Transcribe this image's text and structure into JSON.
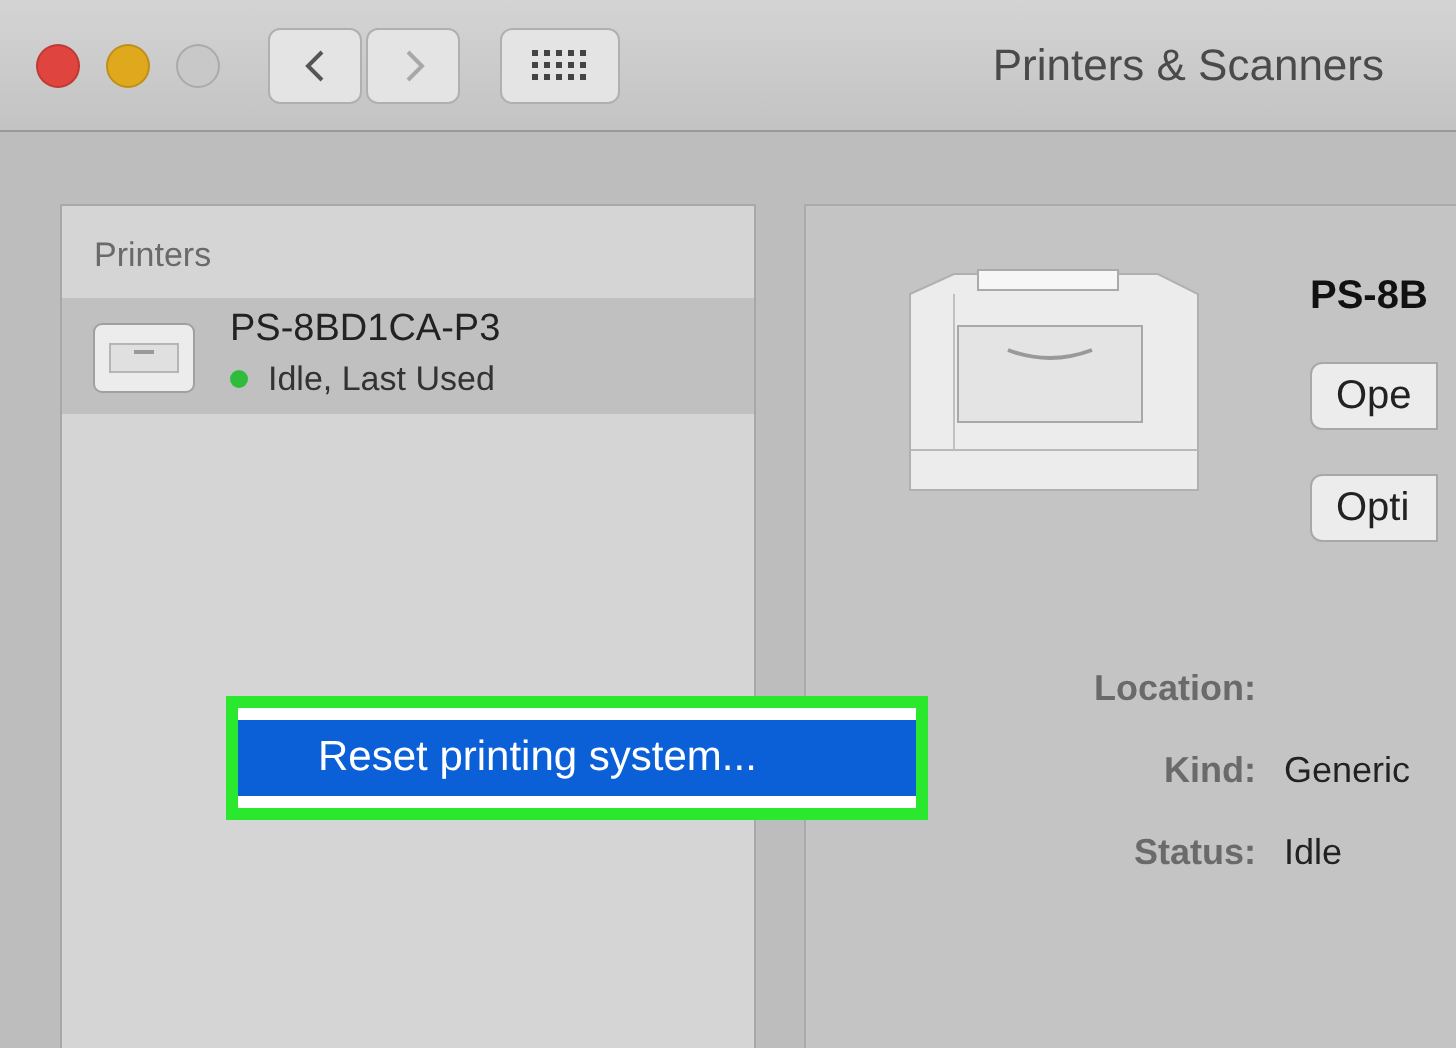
{
  "window": {
    "title": "Printers & Scanners"
  },
  "toolbar": {
    "back": {
      "disabled": false
    },
    "forward": {
      "disabled": true
    }
  },
  "printers_list": {
    "header": "Printers",
    "items": [
      {
        "name": "PS-8BD1CA-P3",
        "status": "Idle, Last Used",
        "color": "#2ebd3b",
        "selected": true
      }
    ]
  },
  "detail": {
    "name": "PS-8B",
    "buttons": [
      "Ope",
      "Opti"
    ],
    "fields": [
      {
        "label": "Location:"
      },
      {
        "label": "Kind:",
        "value": "Generic"
      },
      {
        "label": "Status:",
        "value": "Idle"
      }
    ]
  },
  "context_menu": {
    "items": [
      {
        "label": "Reset printing system...",
        "selected": true
      }
    ]
  }
}
